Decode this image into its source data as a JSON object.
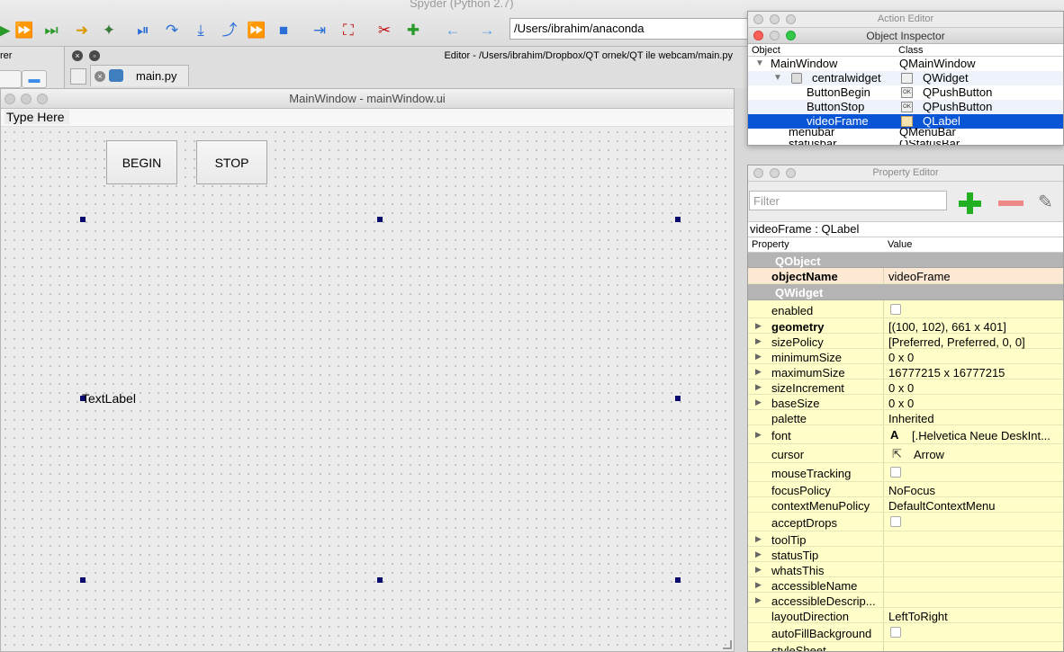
{
  "spyder": {
    "title": "Spyder (Python 2.7)",
    "path_value": "/Users/ibrahim/anaconda"
  },
  "left_panel": {
    "label": "rer"
  },
  "editor": {
    "path": "Editor - /Users/ibrahim/Dropbox/QT ornek/QT ile webcam/main.py",
    "tab_label": "main.py"
  },
  "main_window": {
    "title": "MainWindow - mainWindow.ui",
    "menu_placeholder": "Type Here",
    "buttons": {
      "begin": "BEGIN",
      "stop": "STOP"
    },
    "text_label": "TextLabel"
  },
  "action_editor": {
    "title": "Action Editor"
  },
  "object_inspector": {
    "title": "Object Inspector",
    "col_object": "Object",
    "col_class": "Class",
    "rows": [
      {
        "object": "MainWindow",
        "class": "QMainWindow"
      },
      {
        "object": "centralwidget",
        "class": "QWidget"
      },
      {
        "object": "ButtonBegin",
        "class": "QPushButton"
      },
      {
        "object": "ButtonStop",
        "class": "QPushButton"
      },
      {
        "object": "videoFrame",
        "class": "QLabel"
      },
      {
        "object": "menubar",
        "class": "QMenuBar"
      },
      {
        "object": "statusbar",
        "class": "QStatusBar"
      }
    ]
  },
  "property_editor": {
    "title": "Property Editor",
    "filter_placeholder": "Filter",
    "subject": "videoFrame : QLabel",
    "col_property": "Property",
    "col_value": "Value",
    "groups": {
      "qobject": "QObject",
      "qwidget": "QWidget"
    },
    "props": [
      {
        "name": "objectName",
        "value": "videoFrame"
      },
      {
        "name": "enabled",
        "value": ""
      },
      {
        "name": "geometry",
        "value": "[(100, 102), 661 x 401]"
      },
      {
        "name": "sizePolicy",
        "value": "[Preferred, Preferred, 0, 0]"
      },
      {
        "name": "minimumSize",
        "value": "0 x 0"
      },
      {
        "name": "maximumSize",
        "value": "16777215 x 16777215"
      },
      {
        "name": "sizeIncrement",
        "value": "0 x 0"
      },
      {
        "name": "baseSize",
        "value": "0 x 0"
      },
      {
        "name": "palette",
        "value": "Inherited"
      },
      {
        "name": "font",
        "value": "[.Helvetica Neue DeskInt..."
      },
      {
        "name": "cursor",
        "value": "Arrow"
      },
      {
        "name": "mouseTracking",
        "value": ""
      },
      {
        "name": "focusPolicy",
        "value": "NoFocus"
      },
      {
        "name": "contextMenuPolicy",
        "value": "DefaultContextMenu"
      },
      {
        "name": "acceptDrops",
        "value": ""
      },
      {
        "name": "toolTip",
        "value": ""
      },
      {
        "name": "statusTip",
        "value": ""
      },
      {
        "name": "whatsThis",
        "value": ""
      },
      {
        "name": "accessibleName",
        "value": ""
      },
      {
        "name": "accessibleDescrip...",
        "value": ""
      },
      {
        "name": "layoutDirection",
        "value": "LeftToRight"
      },
      {
        "name": "autoFillBackground",
        "value": ""
      },
      {
        "name": "styleSheet",
        "value": ""
      }
    ],
    "font_icon": "A"
  },
  "colors": {
    "selection": "#0a55d6",
    "property_bg": "#fffec8",
    "objectname_bg": "#fde9d3",
    "group_bg": "#b4b4b4",
    "handle": "#0a0a6e"
  },
  "icons": [
    "run-icon",
    "debug-icon",
    "step-icon",
    "stop-icon",
    "maximize-icon",
    "tools-icon",
    "python-path-icon",
    "back-arrow-icon",
    "forward-arrow-icon",
    "add-icon",
    "remove-icon",
    "wrench-icon"
  ]
}
